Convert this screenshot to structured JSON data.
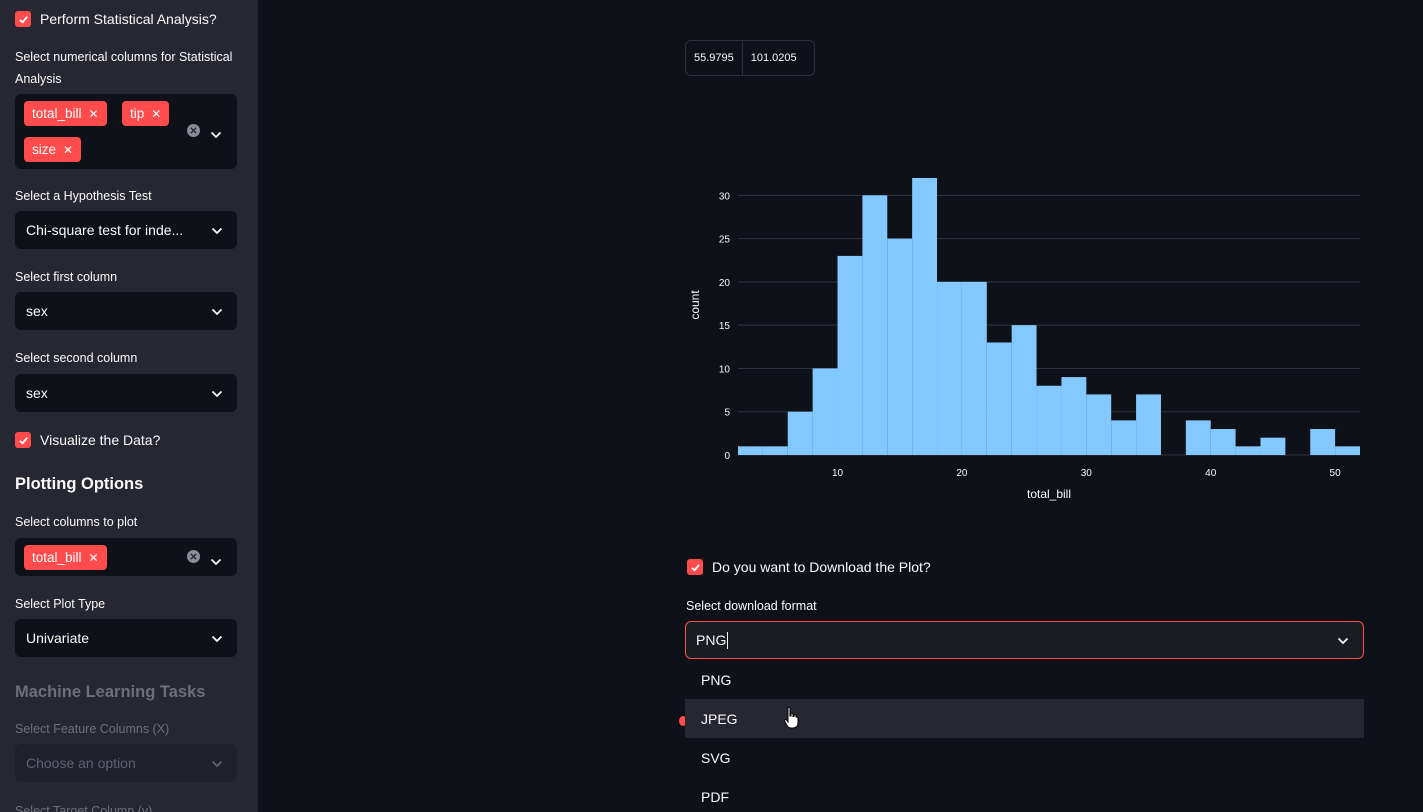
{
  "sidebar": {
    "stats_check": {
      "label": "Perform Statistical Analysis?",
      "checked": true
    },
    "num_cols_label": "Select numerical columns for Statistical Analysis",
    "num_cols_line1": "Select numerical columns for Statistical",
    "num_cols_line2": "Analysis",
    "num_cols_tags": [
      "total_bill",
      "tip",
      "size"
    ],
    "hypo_label": "Select a Hypothesis Test",
    "hypo_value": "Chi-square test for inde...",
    "first_col_label": "Select first column",
    "first_col_value": "sex",
    "second_col_label": "Select second column",
    "second_col_value": "sex",
    "viz_check": {
      "label": "Visualize the Data?",
      "checked": true
    },
    "plotting_title": "Plotting Options",
    "plot_cols_label": "Select columns to plot",
    "plot_cols_tags": [
      "total_bill"
    ],
    "plot_type_label": "Select Plot Type",
    "plot_type_value": "Univariate",
    "ml_title": "Machine Learning Tasks",
    "feature_label": "Select Feature Columns (X)",
    "feature_placeholder": "Choose an option",
    "target_label": "Select Target Column (y)"
  },
  "main": {
    "table_cells": [
      "55.9795",
      "101.0205"
    ],
    "download_check": {
      "label": "Do you want to Download the Plot?",
      "checked": true
    },
    "format_label": "Select download format",
    "format_value": "PNG",
    "format_options": [
      "PNG",
      "JPEG",
      "SVG",
      "PDF"
    ],
    "hovered_option": "JPEG"
  },
  "colors": {
    "accent": "#ff4b4b",
    "bar": "#83c9ff",
    "sidebar_bg": "#262730",
    "app_bg": "#0e1117"
  },
  "chart_data": {
    "type": "bar",
    "xlabel": "total_bill",
    "ylabel": "count",
    "xlim": [
      2,
      52
    ],
    "ylim": [
      0,
      32
    ],
    "xticks": [
      10,
      20,
      30,
      40,
      50
    ],
    "yticks": [
      0,
      5,
      10,
      15,
      20,
      25,
      30
    ],
    "bin_width": 2,
    "bins": [
      {
        "start": 2,
        "count": 1
      },
      {
        "start": 4,
        "count": 1
      },
      {
        "start": 6,
        "count": 5
      },
      {
        "start": 8,
        "count": 10
      },
      {
        "start": 10,
        "count": 23
      },
      {
        "start": 12,
        "count": 30
      },
      {
        "start": 14,
        "count": 25
      },
      {
        "start": 16,
        "count": 32
      },
      {
        "start": 18,
        "count": 20
      },
      {
        "start": 20,
        "count": 20
      },
      {
        "start": 22,
        "count": 13
      },
      {
        "start": 24,
        "count": 15
      },
      {
        "start": 26,
        "count": 8
      },
      {
        "start": 28,
        "count": 9
      },
      {
        "start": 30,
        "count": 7
      },
      {
        "start": 32,
        "count": 4
      },
      {
        "start": 34,
        "count": 7
      },
      {
        "start": 36,
        "count": 0
      },
      {
        "start": 38,
        "count": 4
      },
      {
        "start": 40,
        "count": 3
      },
      {
        "start": 42,
        "count": 1
      },
      {
        "start": 44,
        "count": 2
      },
      {
        "start": 46,
        "count": 0
      },
      {
        "start": 48,
        "count": 3
      },
      {
        "start": 50,
        "count": 1
      }
    ],
    "grid": true,
    "legend": "none"
  }
}
